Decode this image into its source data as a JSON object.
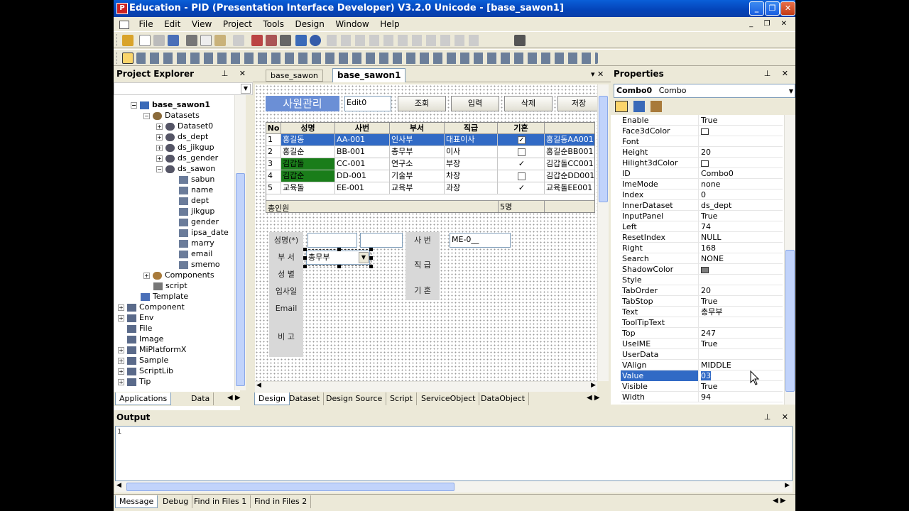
{
  "window": {
    "title": "Education - PID (Presentation Interface Developer) V3.2.0 Unicode - [base_sawon1]",
    "minimize": "_",
    "maximize": "❐",
    "close": "✕"
  },
  "menu": [
    "File",
    "Edit",
    "View",
    "Project",
    "Tools",
    "Design",
    "Window",
    "Help"
  ],
  "project_explorer": {
    "title": "Project Explorer",
    "root": "base_sawon1",
    "datasets_label": "Datasets",
    "datasets": [
      "Dataset0",
      "ds_dept",
      "ds_jikgup",
      "ds_gender",
      "ds_sawon"
    ],
    "columns": [
      "sabun",
      "name",
      "dept",
      "jikgup",
      "gender",
      "ipsa_date",
      "marry",
      "email",
      "smemo"
    ],
    "components": "Components",
    "script": "script",
    "template": "Template",
    "folders": [
      "Component",
      "Env",
      "File",
      "Image",
      "MiPlatformX",
      "Sample",
      "ScriptLib",
      "Tip"
    ],
    "tabs": [
      "Applications",
      "Data"
    ]
  },
  "document": {
    "tabs": [
      "base_sawon",
      "base_sawon1"
    ],
    "title_label": "사원관리",
    "edit_value": "Edit0",
    "buttons": [
      "조회",
      "입력",
      "삭제",
      "저장"
    ],
    "grid": {
      "headers": [
        "No",
        "성명",
        "사번",
        "부서",
        "직급",
        "기혼",
        ""
      ],
      "rows": [
        {
          "no": "1",
          "name": "홍길동",
          "sabun": "AA-001",
          "dept": "인사부",
          "jikgup": "대표이사",
          "married": true,
          "extra": "홍길동AA001"
        },
        {
          "no": "2",
          "name": "홍길순",
          "sabun": "BB-001",
          "dept": "총무부",
          "jikgup": "이사",
          "married": false,
          "extra": "홍길순BB001"
        },
        {
          "no": "3",
          "name": "김갑돌",
          "sabun": "CC-001",
          "dept": "연구소",
          "jikgup": "부장",
          "married": true,
          "extra": "김갑돌CC001"
        },
        {
          "no": "4",
          "name": "김갑순",
          "sabun": "DD-001",
          "dept": "기술부",
          "jikgup": "차장",
          "married": false,
          "extra": "김갑순DD001"
        },
        {
          "no": "5",
          "name": "교육돌",
          "sabun": "EE-001",
          "dept": "교육부",
          "jikgup": "과장",
          "married": true,
          "extra": "교육돌EE001"
        }
      ],
      "footer_label": "총인원",
      "footer_count": "5명"
    },
    "form_labels_left": [
      "성명(*)",
      "부 서",
      "성 별",
      "입사일",
      "Email",
      "비 고"
    ],
    "form_labels_right": [
      "사 번",
      "직 급",
      "기 혼"
    ],
    "sabun_mask": "ME-0__",
    "combo_value": "총무부",
    "bottom_tabs": [
      "Design",
      "Dataset",
      "Design Source",
      "Script",
      "ServiceObject",
      "DataObject"
    ]
  },
  "properties": {
    "title": "Properties",
    "object_name": "Combo0",
    "object_type": "Combo",
    "rows": [
      {
        "name": "Enable",
        "value": "True"
      },
      {
        "name": "Face3dColor",
        "value": "",
        "swatch": "#ffffff"
      },
      {
        "name": "Font",
        "value": ""
      },
      {
        "name": "Height",
        "value": "20"
      },
      {
        "name": "Hilight3dColor",
        "value": "",
        "swatch": "#ffffff"
      },
      {
        "name": "ID",
        "value": "Combo0"
      },
      {
        "name": "ImeMode",
        "value": "none"
      },
      {
        "name": "Index",
        "value": "0"
      },
      {
        "name": "InnerDataset",
        "value": "ds_dept"
      },
      {
        "name": "InputPanel",
        "value": "True"
      },
      {
        "name": "Left",
        "value": "74"
      },
      {
        "name": "ResetIndex",
        "value": "NULL"
      },
      {
        "name": "Right",
        "value": "168"
      },
      {
        "name": "Search",
        "value": "NONE"
      },
      {
        "name": "ShadowColor",
        "value": "",
        "swatch": "#808080"
      },
      {
        "name": "Style",
        "value": ""
      },
      {
        "name": "TabOrder",
        "value": "20"
      },
      {
        "name": "TabStop",
        "value": "True"
      },
      {
        "name": "Text",
        "value": "총무부"
      },
      {
        "name": "ToolTipText",
        "value": ""
      },
      {
        "name": "Top",
        "value": "247"
      },
      {
        "name": "UseIME",
        "value": "True"
      },
      {
        "name": "UserData",
        "value": ""
      },
      {
        "name": "VAlign",
        "value": "MIDDLE"
      },
      {
        "name": "Value",
        "value": "03",
        "selected": true
      },
      {
        "name": "Visible",
        "value": "True"
      },
      {
        "name": "Width",
        "value": "94"
      }
    ]
  },
  "output": {
    "title": "Output",
    "line": "1"
  },
  "output_tabs": [
    "Message",
    "Debug",
    "Find in Files 1",
    "Find in Files 2"
  ],
  "colors": {
    "title_blue": "#0443b8",
    "selection": "#316ac5",
    "green_cell": "#1a7d1a",
    "label_blue": "#6b8fd6"
  }
}
